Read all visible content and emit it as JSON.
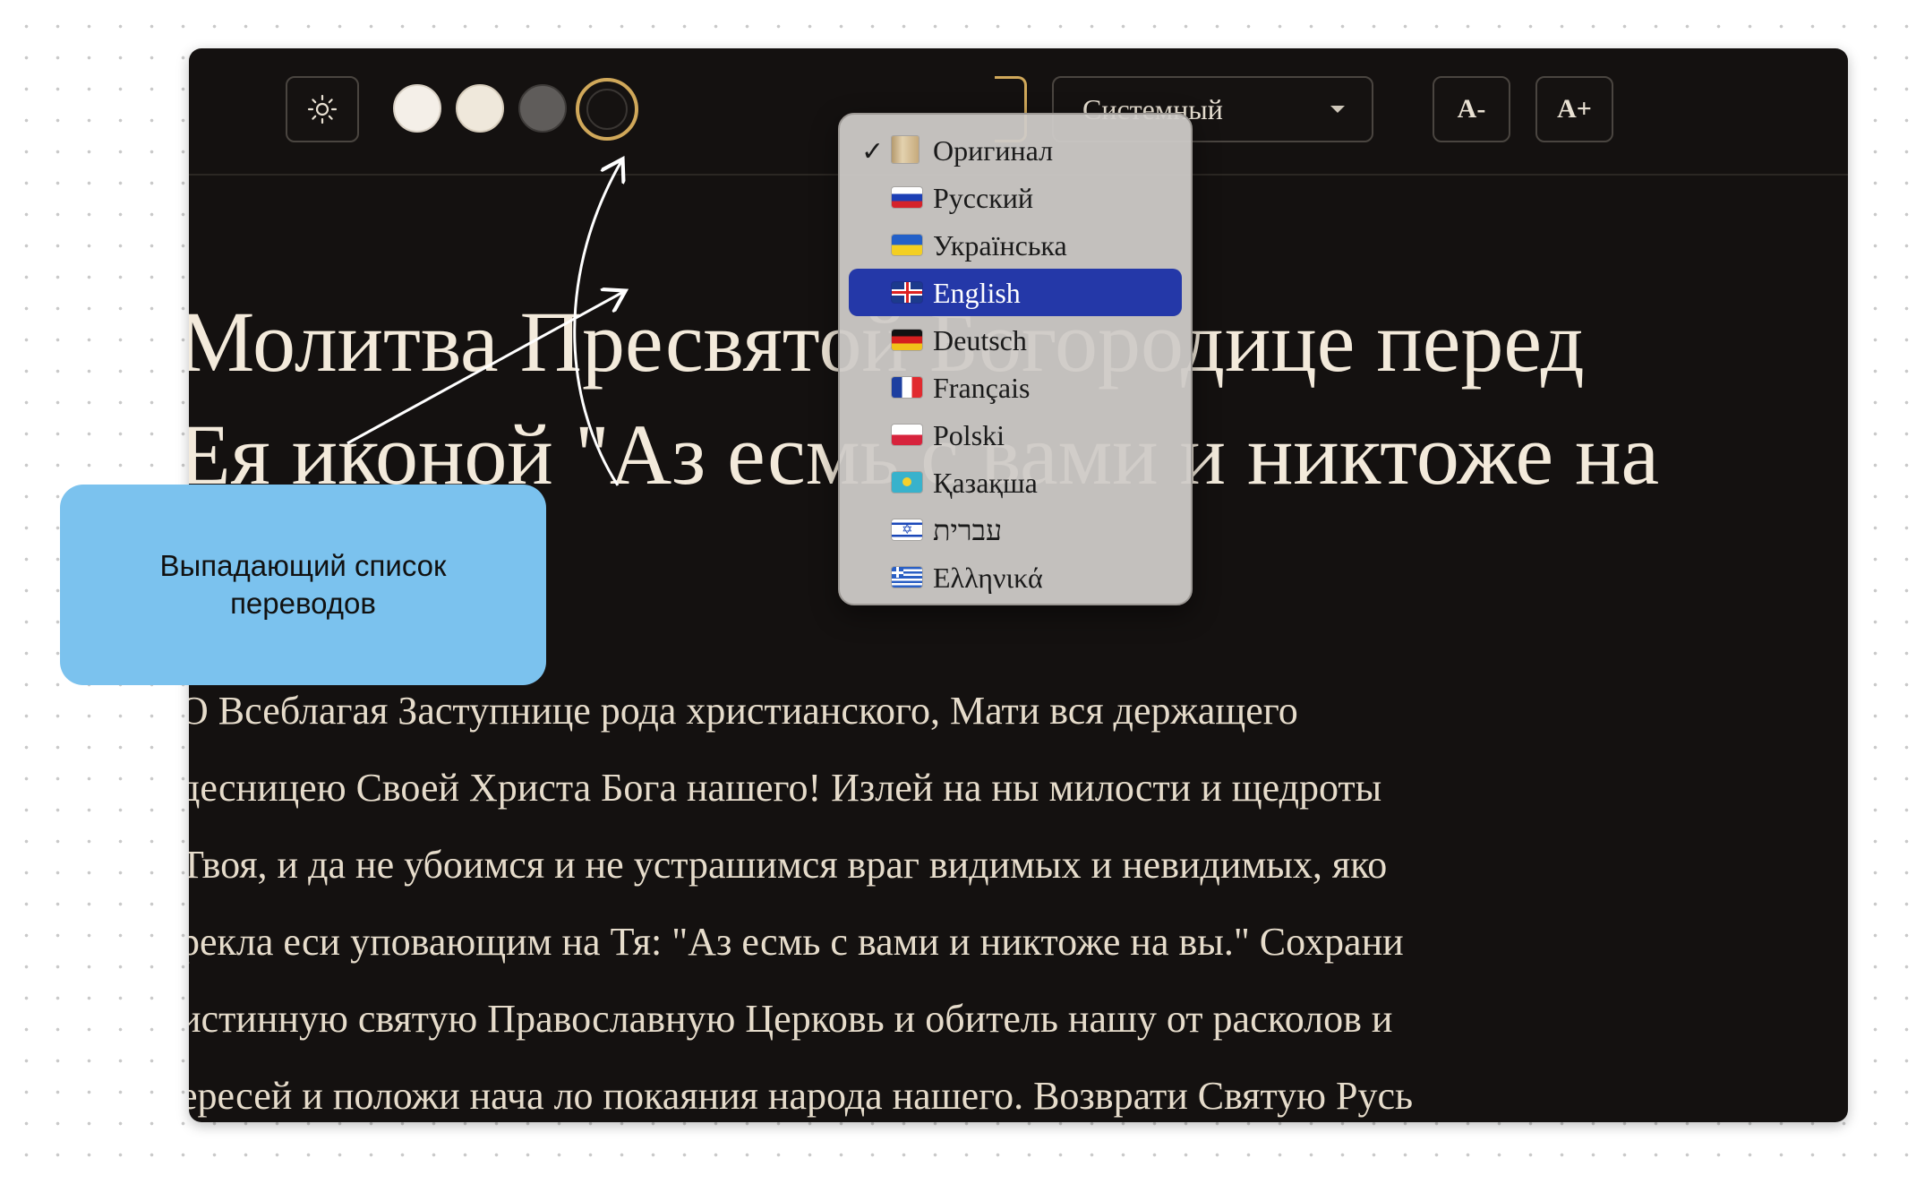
{
  "toolbar": {
    "theme_icon": "sun-icon",
    "swatch_names": [
      "light",
      "sepia",
      "gray",
      "dark"
    ],
    "font_select_value": "Системный",
    "font_decrease_label": "A-",
    "font_increase_label": "A+"
  },
  "content": {
    "title_lines": [
      "Молитва Пресвятой Богородице перед",
      "Ея иконой \"Аз есмь с вами и никтоже на"
    ],
    "body_lines": [
      "О Всеблагая Заступнице рода христианского, Мати вся держащего",
      "десницею Своей Христа Бога нашего! Излей на ны милости и щедроты",
      "Твоя, и да не убоимся и не устрашимся враг видимых и невидимых, яко",
      "рекла еси уповающим на Тя: \"Аз есмь с вами и никтоже на вы.\" Сохрани",
      "истинную святую Православную Церковь и обитель нашу от расколов и",
      "ересей и положи нача ло покаяния народа нашего. Возврати Святую Русь"
    ]
  },
  "dropdown": {
    "items": [
      {
        "label": "Оригинал",
        "flag": "scroll-icon",
        "checked": true
      },
      {
        "label": "Русский",
        "flag": "flag-ru-icon"
      },
      {
        "label": "Українська",
        "flag": "flag-ua-icon"
      },
      {
        "label": "English",
        "flag": "flag-gb-icon",
        "highlighted": true
      },
      {
        "label": "Deutsch",
        "flag": "flag-de-icon"
      },
      {
        "label": "Français",
        "flag": "flag-fr-icon"
      },
      {
        "label": "Polski",
        "flag": "flag-pl-icon"
      },
      {
        "label": "Қазақша",
        "flag": "flag-kz-icon"
      },
      {
        "label": "עברית",
        "flag": "flag-il-icon"
      },
      {
        "label": "Ελληνικά",
        "flag": "flag-gr-icon"
      }
    ]
  },
  "annotation": {
    "callout_text": "Выпадающий список переводов"
  },
  "colors": {
    "background": "#141110",
    "accent_gold": "#d0a85a",
    "highlight": "#2438a8",
    "callout": "#7bc2ee"
  }
}
